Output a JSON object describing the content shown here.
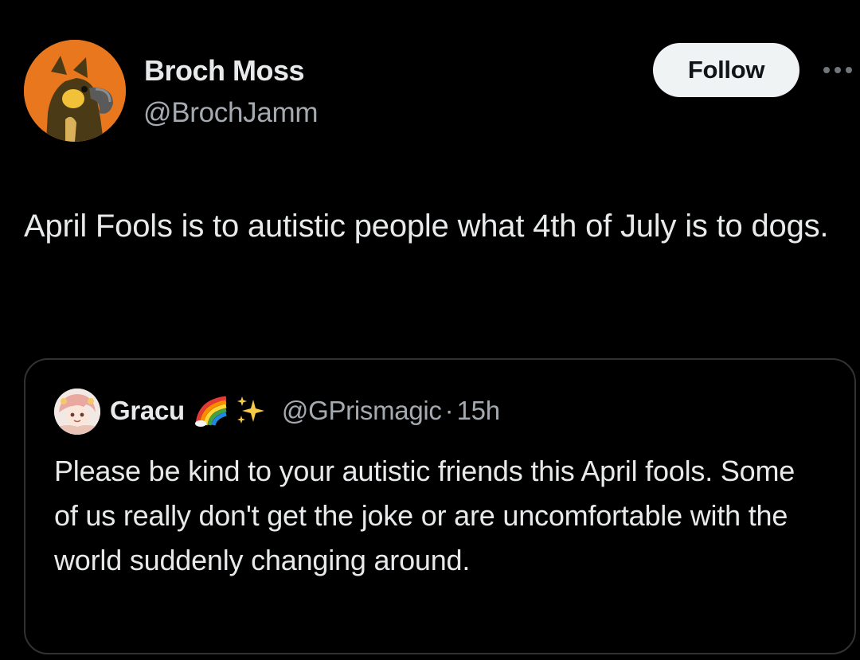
{
  "post": {
    "author": {
      "display_name": "Broch Moss",
      "handle": "@BrochJamm",
      "avatar": "bird-character-avatar"
    },
    "follow_label": "Follow",
    "more_icon": "more-options-icon",
    "text": "April Fools is to autistic people what 4th of July is to dogs."
  },
  "quoted_post": {
    "author": {
      "display_name": "Gracu",
      "emoji": [
        "rainbow",
        "sparkles"
      ],
      "handle": "@GPrismagic",
      "avatar": "anime-character-avatar"
    },
    "separator": "·",
    "time": "15h",
    "text": "Please be kind to your autistic friends this April fools. Some of us really don't get the joke or are uncomfortable with the world suddenly changing around."
  },
  "colors": {
    "background": "#000000",
    "primary_text": "#e7e9ea",
    "secondary_text": "#a5aab0",
    "border": "#2f3336",
    "follow_bg": "#eff3f4"
  }
}
